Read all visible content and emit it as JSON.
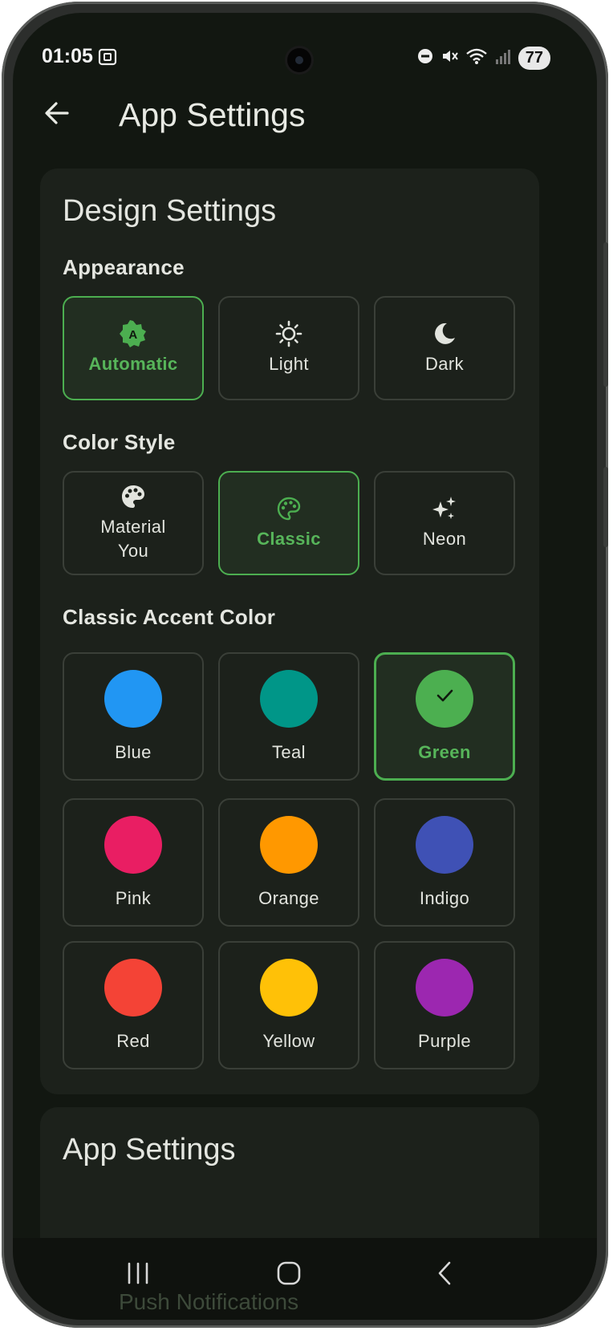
{
  "status_bar": {
    "time": "01:05",
    "battery": "77"
  },
  "app_bar": {
    "title": "App Settings"
  },
  "design_card": {
    "title": "Design Settings",
    "appearance": {
      "label": "Appearance",
      "options": [
        {
          "label": "Automatic",
          "icon": "brightness-auto-icon",
          "selected": true
        },
        {
          "label": "Light",
          "icon": "sun-icon",
          "selected": false
        },
        {
          "label": "Dark",
          "icon": "moon-icon",
          "selected": false
        }
      ]
    },
    "color_style": {
      "label": "Color Style",
      "options": [
        {
          "label_line1": "Material",
          "label_line2": "You",
          "icon": "palette-filled-icon",
          "selected": false
        },
        {
          "label": "Classic",
          "icon": "palette-outline-icon",
          "selected": true
        },
        {
          "label": "Neon",
          "icon": "sparkles-icon",
          "selected": false
        }
      ]
    },
    "accent": {
      "label": "Classic Accent Color",
      "colors": [
        {
          "name": "Blue",
          "hex": "#2196f3",
          "selected": false
        },
        {
          "name": "Teal",
          "hex": "#009688",
          "selected": false
        },
        {
          "name": "Green",
          "hex": "#4caf50",
          "selected": true
        },
        {
          "name": "Pink",
          "hex": "#e91e63",
          "selected": false
        },
        {
          "name": "Orange",
          "hex": "#ff9800",
          "selected": false
        },
        {
          "name": "Indigo",
          "hex": "#3f51b5",
          "selected": false
        },
        {
          "name": "Red",
          "hex": "#f44336",
          "selected": false
        },
        {
          "name": "Yellow",
          "hex": "#ffc107",
          "selected": false
        },
        {
          "name": "Purple",
          "hex": "#9c27b0",
          "selected": false
        }
      ]
    }
  },
  "app_settings_card": {
    "title": "App Settings",
    "items": [
      {
        "label": "Push Notifications"
      }
    ]
  },
  "colors": {
    "accent": "#4caf50",
    "background": "#121711",
    "card": "#1c211b"
  }
}
